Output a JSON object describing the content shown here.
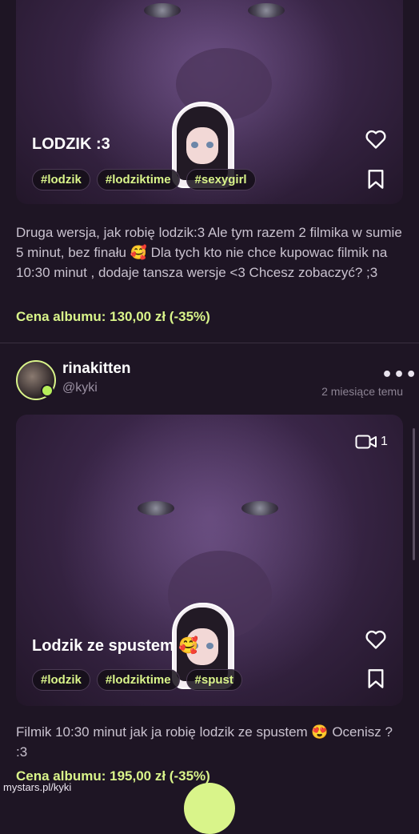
{
  "posts": [
    {
      "title": "LODZIK :3",
      "tags": [
        "#lodzik",
        "#lodziktime",
        "#sexygirl"
      ],
      "description": "Druga wersja, jak robię lodzik:3 Ale tym razem 2 filmika w sumie 5 minut, bez finału 🥰 Dla tych kto nie chce kupowac filmik na 10:30 minut , dodaje tansza wersje <3 Chcesz zobaczyć? ;3",
      "price": "Cena albumu: 130,00 zł (-35%)"
    },
    {
      "author": {
        "name": "rinakitten",
        "handle": "@kyki",
        "time": "2 miesiące temu"
      },
      "media_count": "1",
      "title": "Lodzik ze spustem 🥰",
      "tags": [
        "#lodzik",
        "#lodziktime",
        "#spust"
      ],
      "description": "Filmik 10:30 minut jak ja robię lodzik ze spustem 😍 Ocenisz ? :3",
      "price": "Cena albumu: 195,00 zł (-35%)"
    }
  ],
  "icons": {
    "like": "heart-icon",
    "save": "bookmark-icon",
    "more": "more-dots-icon",
    "video": "video-icon"
  },
  "colors": {
    "background": "#1e1524",
    "accent": "#d9f48a",
    "online": "#b6ef5a"
  },
  "footer": {
    "url": "mystars.pl/kyki"
  }
}
